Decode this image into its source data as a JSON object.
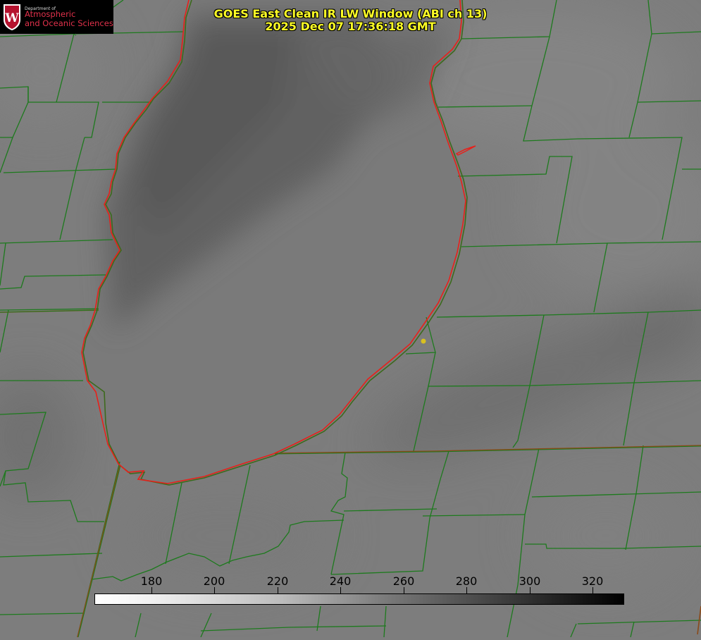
{
  "logo": {
    "department": "Department of",
    "line1": "Atmospheric",
    "line2": "and Oceanic Sciences",
    "crest_letter": "W"
  },
  "title": {
    "line1": "GOES East Clean IR LW Window (ABI ch 13)",
    "line2": "2025 Dec 07 17:36:18 GMT"
  },
  "colorbar": {
    "min": 162,
    "max": 330,
    "ticks": [
      "180",
      "200",
      "220",
      "240",
      "260",
      "280",
      "300",
      "320"
    ],
    "colormap": "white-to-black (brightness temperature, K)"
  },
  "colors": {
    "title_text": "#ffff26",
    "county_lines": "#1d7a1d",
    "coastline": "#e8201a",
    "marker": "#e0c020"
  }
}
